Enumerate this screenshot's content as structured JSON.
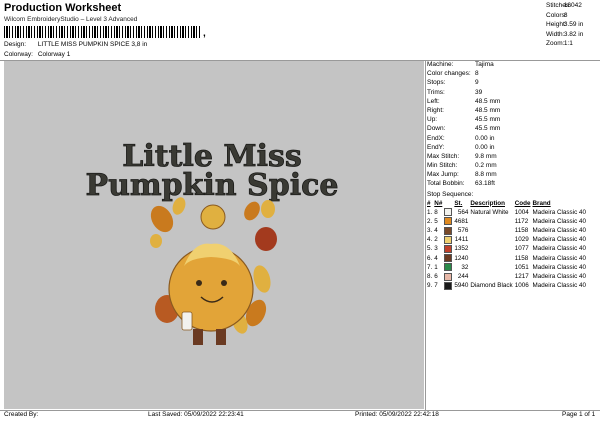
{
  "header": {
    "title": "Production Worksheet",
    "subtitle": "Wilcom EmbroideryStudio – Level 3 Advanced",
    "barcode_suffix": ",",
    "design_label": "Design:",
    "design_value": "LITTLE MISS PUMPKIN SPICE 3,8 in",
    "colorway_label": "Colorway:",
    "colorway_value": "Colorway 1"
  },
  "stats": [
    {
      "label": "Stitches:",
      "value": "16042"
    },
    {
      "label": "Colors:",
      "value": "8"
    },
    {
      "label": "Height:",
      "value": "3.59 in"
    },
    {
      "label": "Width:",
      "value": "3.82 in"
    },
    {
      "label": "Zoom:",
      "value": "1:1"
    }
  ],
  "design_art": {
    "line1": "Little Miss",
    "line2": "Pumpkin Spice",
    "text_color": "#3a3a34",
    "body_color": "#e2a438",
    "leaf_colors": [
      "#c97a1e",
      "#a33a1e",
      "#e0b040",
      "#b85a22"
    ],
    "boot_color": "#6a3a22"
  },
  "machine_info": [
    {
      "label": "Machine:",
      "value": "Tajima"
    },
    {
      "label": "Color changes:",
      "value": "8"
    },
    {
      "label": "Stops:",
      "value": "9"
    },
    {
      "label": "Trims:",
      "value": "39"
    },
    {
      "label": "Left:",
      "value": "48.5 mm"
    },
    {
      "label": "Right:",
      "value": "48.5 mm"
    },
    {
      "label": "Up:",
      "value": "45.5 mm"
    },
    {
      "label": "Down:",
      "value": "45.5 mm"
    },
    {
      "label": "EndX:",
      "value": "0.00 in"
    },
    {
      "label": "EndY:",
      "value": "0.00 in"
    },
    {
      "label": "Max Stitch:",
      "value": "9.8 mm"
    },
    {
      "label": "Min Stitch:",
      "value": "0.2 mm"
    },
    {
      "label": "Max Jump:",
      "value": "8.8 mm"
    },
    {
      "label": "Total Bobbin:",
      "value": "63.18ft"
    }
  ],
  "sequence": {
    "title": "Stop Sequence:",
    "headers": [
      "#",
      "N#",
      "St.",
      "Description",
      "Code",
      "Brand"
    ],
    "rows": [
      {
        "num": "1.",
        "n": "8",
        "color": "#f2f2ee",
        "st": "564",
        "desc": "Natural White",
        "code": "1004",
        "brand": "Madeira Classic 40"
      },
      {
        "num": "2.",
        "n": "5",
        "color": "#e08a20",
        "st": "4681",
        "desc": "",
        "code": "1172",
        "brand": "Madeira Classic 40"
      },
      {
        "num": "3.",
        "n": "4",
        "color": "#7a4a2a",
        "st": "576",
        "desc": "",
        "code": "1158",
        "brand": "Madeira Classic 40"
      },
      {
        "num": "4.",
        "n": "2",
        "color": "#f0d070",
        "st": "1411",
        "desc": "",
        "code": "1029",
        "brand": "Madeira Classic 40"
      },
      {
        "num": "5.",
        "n": "3",
        "color": "#c0402a",
        "st": "1352",
        "desc": "",
        "code": "1077",
        "brand": "Madeira Classic 40"
      },
      {
        "num": "6.",
        "n": "4",
        "color": "#6a3a22",
        "st": "1240",
        "desc": "",
        "code": "1158",
        "brand": "Madeira Classic 40"
      },
      {
        "num": "7.",
        "n": "1",
        "color": "#2a8a4a",
        "st": "32",
        "desc": "",
        "code": "1051",
        "brand": "Madeira Classic 40"
      },
      {
        "num": "8.",
        "n": "6",
        "color": "#e8b8a8",
        "st": "244",
        "desc": "",
        "code": "1217",
        "brand": "Madeira Classic 40"
      },
      {
        "num": "9.",
        "n": "7",
        "color": "#1a1a1a",
        "st": "5940",
        "desc": "Diamond Black",
        "code": "1006",
        "brand": "Madeira Classic 40"
      }
    ]
  },
  "footer": {
    "created_by": "Created By:",
    "last_saved": "Last Saved: 05/09/2022 22:23:41",
    "printed": "Printed: 05/09/2022 22:42:18",
    "page": "Page 1 of 1"
  }
}
